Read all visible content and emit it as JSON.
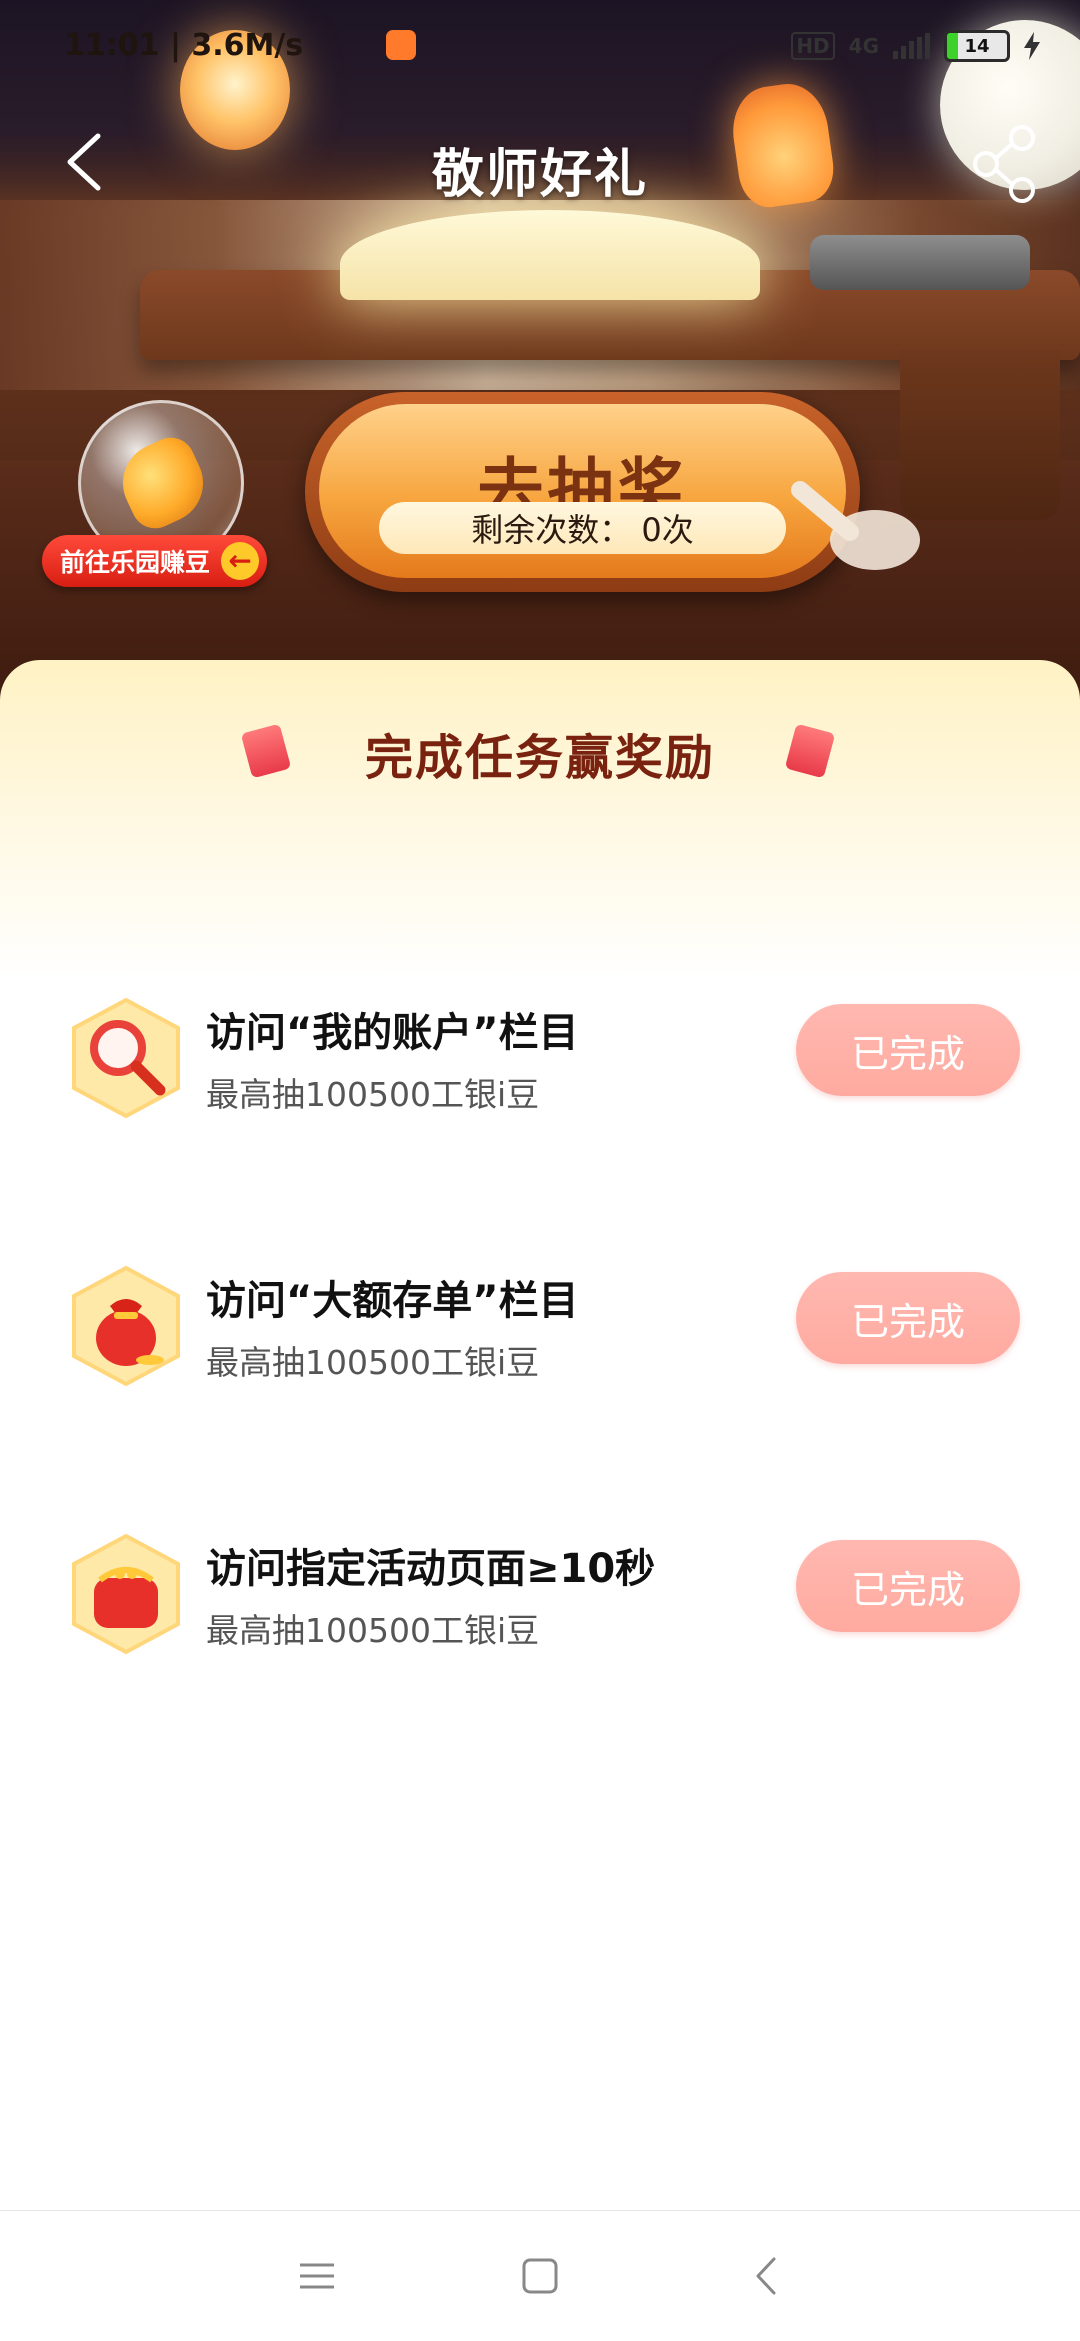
{
  "status_bar": {
    "time": "11:01 | 3.6M/s",
    "network": "4G",
    "hd": "HD",
    "battery": "14"
  },
  "header": {
    "title": "敬师好礼"
  },
  "banner": {
    "goto_paradise_label": "前往乐园赚豆",
    "lottery_label": "去抽奖",
    "remaining_text": "剩余次数： 0次"
  },
  "tasks_section": {
    "heading": "完成任务赢奖励",
    "tasks": [
      {
        "icon": "magnifier-icon",
        "title": "访问“我的账户”栏目",
        "subtitle": "最高抽100500工银i豆",
        "status": "已完成"
      },
      {
        "icon": "money-bag-icon",
        "title": "访问“大额存单”栏目",
        "subtitle": "最高抽100500工银i豆",
        "status": "已完成"
      },
      {
        "icon": "purse-icon",
        "title": "访问指定活动页面≥10秒",
        "subtitle": "最高抽100500工银i豆",
        "status": "已完成"
      }
    ]
  },
  "colors": {
    "title_brown": "#7a2210",
    "done_button": "#ffaaa0",
    "lottery_orange": "#f7a53e"
  }
}
